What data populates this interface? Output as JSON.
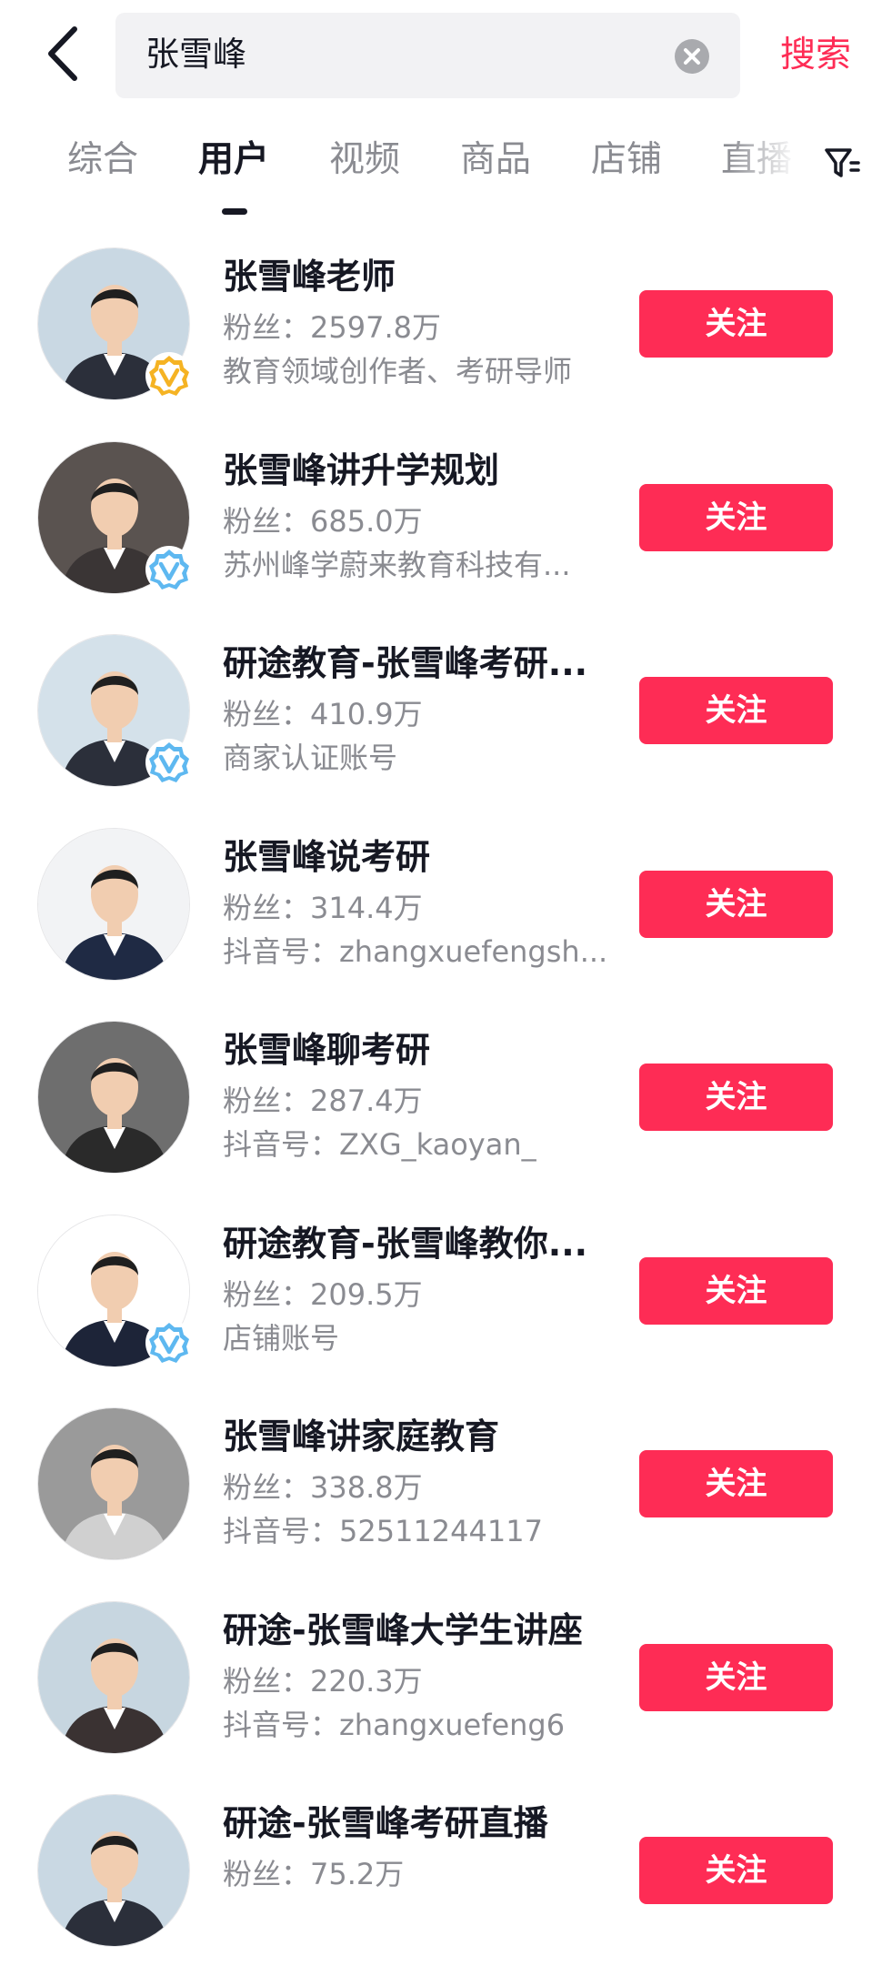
{
  "search": {
    "query": "张雪峰",
    "button_label": "搜索"
  },
  "tabs": [
    {
      "label": "综合",
      "active": false
    },
    {
      "label": "用户",
      "active": true
    },
    {
      "label": "视频",
      "active": false
    },
    {
      "label": "商品",
      "active": false
    },
    {
      "label": "店铺",
      "active": false
    },
    {
      "label": "直播",
      "active": false
    }
  ],
  "colors": {
    "accent": "#fe2c55",
    "gold_badge": "#f5b323",
    "blue_badge": "#5eb8f0"
  },
  "users": [
    {
      "name": "张雪峰老师",
      "fans": "粉丝：2597.8万",
      "desc": "教育领域创作者、考研导师",
      "follow_label": "关注",
      "badge": "gold",
      "avatar_bg": "#c9d8e3",
      "suit": "#2b2f3a"
    },
    {
      "name": "张雪峰讲升学规划",
      "fans": "粉丝：685.0万",
      "desc": "苏州峰学蔚来教育科技有...",
      "follow_label": "关注",
      "badge": "blue",
      "avatar_bg": "#5a5350",
      "suit": "#3a3535"
    },
    {
      "name": "研途教育-张雪峰考研...",
      "fans": "粉丝：410.9万",
      "desc": "商家认证账号",
      "follow_label": "关注",
      "badge": "blue",
      "avatar_bg": "#d4e1ea",
      "suit": "#2b2f3a"
    },
    {
      "name": "张雪峰说考研",
      "fans": "粉丝：314.4万",
      "desc": "抖音号：zhangxuefengsh...",
      "follow_label": "关注",
      "badge": "none",
      "avatar_bg": "#f2f3f5",
      "suit": "#1f2a44"
    },
    {
      "name": "张雪峰聊考研",
      "fans": "粉丝：287.4万",
      "desc": "抖音号：ZXG_kaoyan_",
      "follow_label": "关注",
      "badge": "none",
      "avatar_bg": "#6e6e6e",
      "suit": "#2a2a2a"
    },
    {
      "name": "研途教育-张雪峰教你...",
      "fans": "粉丝：209.5万",
      "desc": "店铺账号",
      "follow_label": "关注",
      "badge": "blue",
      "avatar_bg": "#ffffff",
      "suit": "#1d2438"
    },
    {
      "name": "张雪峰讲家庭教育",
      "fans": "粉丝：338.8万",
      "desc": "抖音号：52511244117",
      "follow_label": "关注",
      "badge": "none",
      "avatar_bg": "#9a9a9a",
      "suit": "#d0d0d0"
    },
    {
      "name": "研途-张雪峰大学生讲座",
      "fans": "粉丝：220.3万",
      "desc": "抖音号：zhangxuefeng6",
      "follow_label": "关注",
      "badge": "none",
      "avatar_bg": "#c7d6e0",
      "suit": "#3a3232"
    },
    {
      "name": "研途-张雪峰考研直播",
      "fans": "粉丝：75.2万",
      "desc": "",
      "follow_label": "关注",
      "badge": "none",
      "avatar_bg": "#c9d8e3",
      "suit": "#2b2f3a"
    }
  ]
}
